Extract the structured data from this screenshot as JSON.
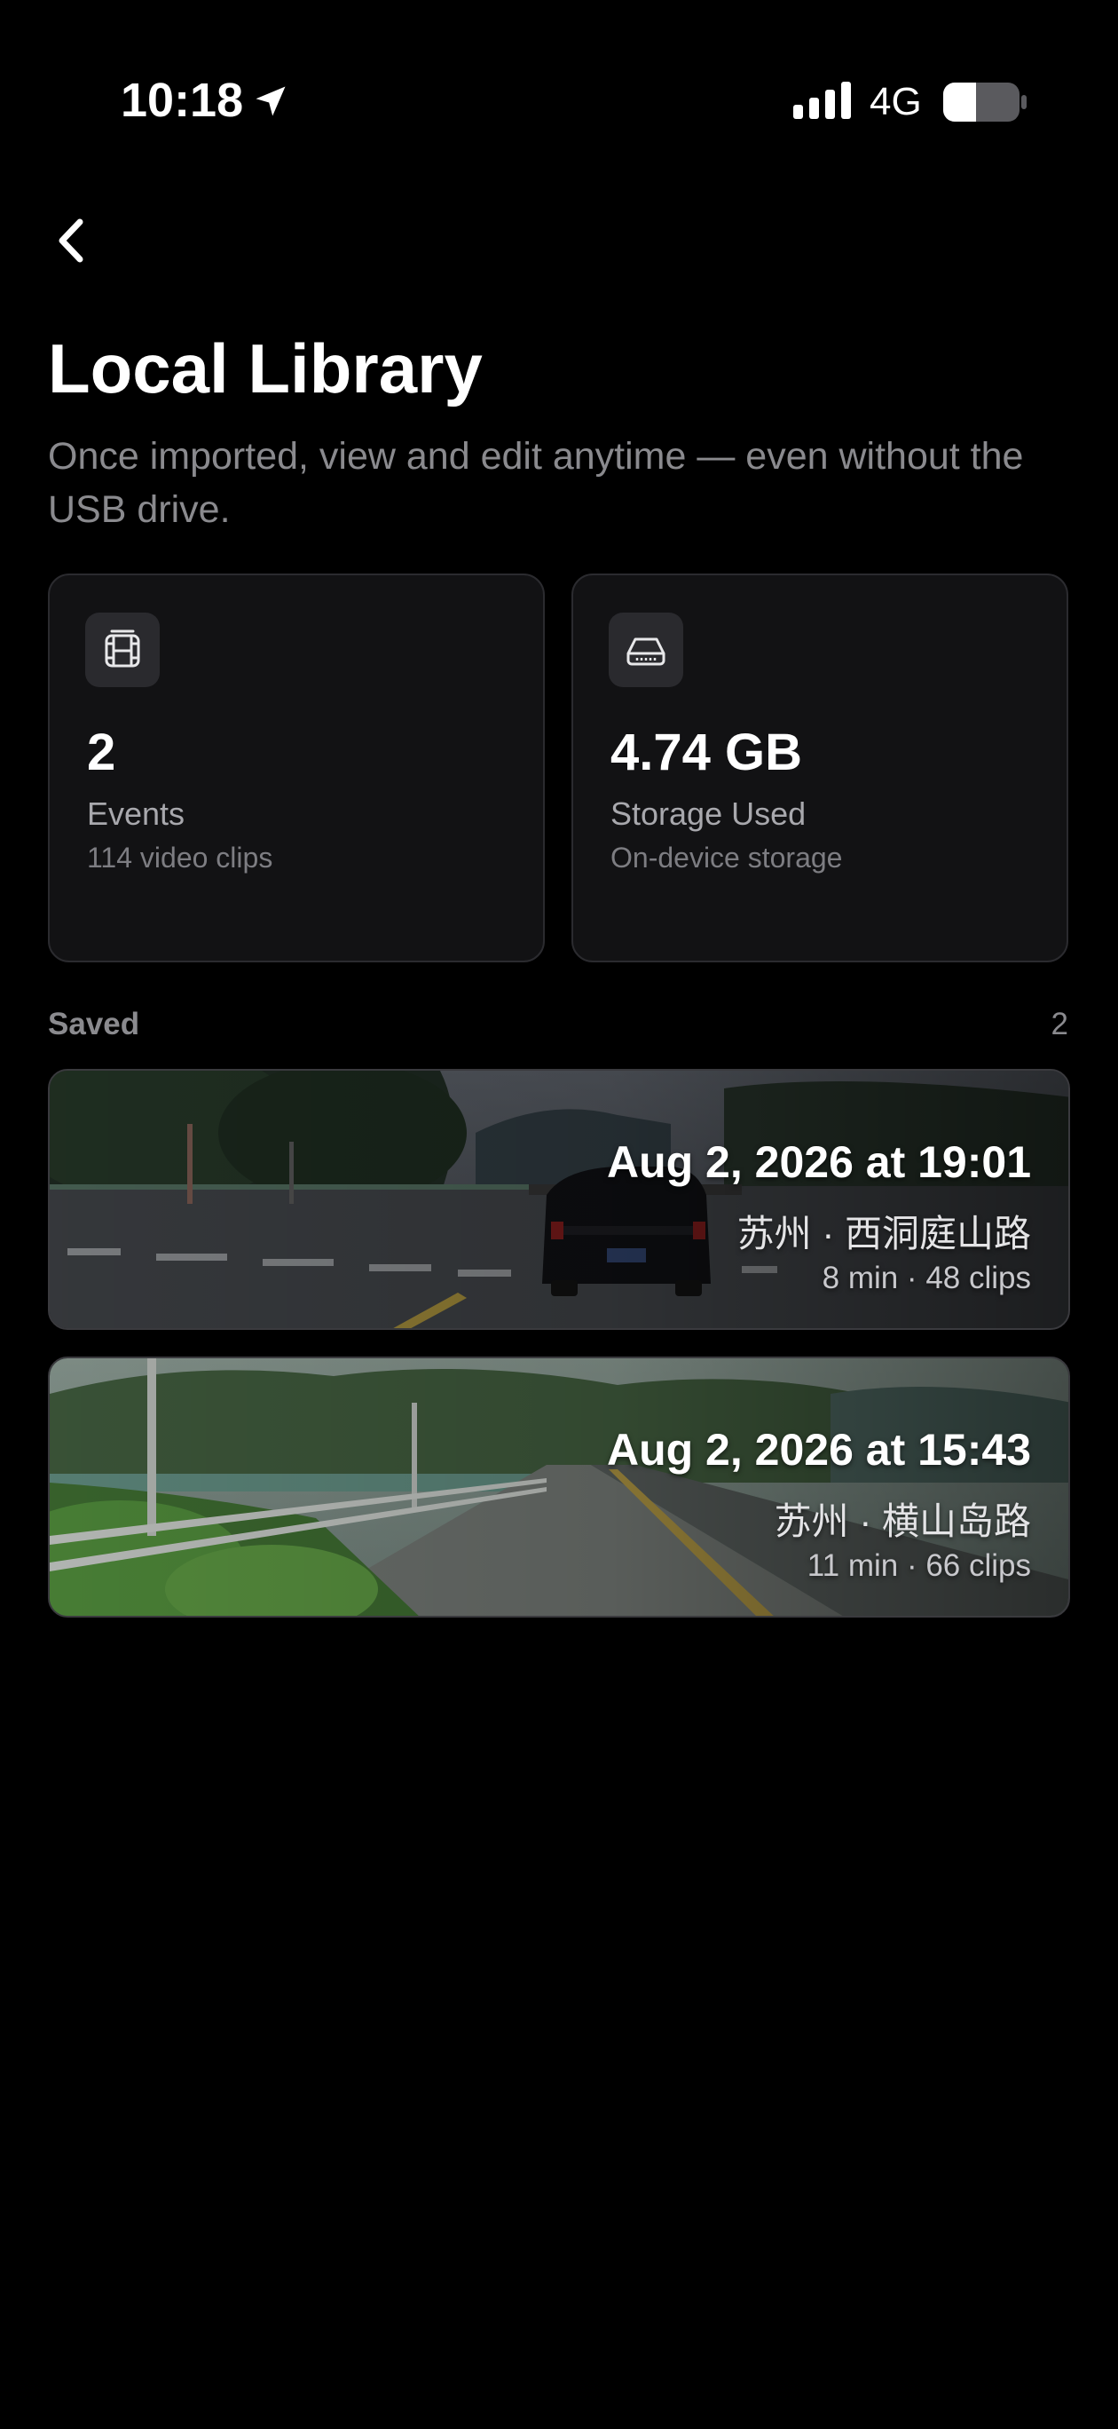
{
  "status_bar": {
    "time": "10:18",
    "network": "4G",
    "icons": [
      "location-arrow-icon",
      "signal-icon",
      "battery-icon"
    ]
  },
  "header": {
    "back_icon": "chevron-left-icon",
    "title": "Local Library",
    "subtitle": "Once imported, view and edit anytime — even without the USB drive."
  },
  "stats": [
    {
      "icon": "film-icon",
      "value": "2",
      "label": "Events",
      "sub": "114 video clips"
    },
    {
      "icon": "drive-icon",
      "value": "4.74 GB",
      "label": "Storage Used",
      "sub": "On-device storage"
    }
  ],
  "saved": {
    "label": "Saved",
    "count": "2",
    "events": [
      {
        "title": "Aug 2, 2026 at 19:01",
        "location": "苏州 · 西洞庭山路",
        "meta": "8 min · 48 clips"
      },
      {
        "title": "Aug 2, 2026 at 15:43",
        "location": "苏州 · 横山岛路",
        "meta": "11 min · 66 clips"
      }
    ]
  },
  "colors": {
    "background": "#000000",
    "card": "#121214",
    "muted_text": "#8a8a8e"
  }
}
